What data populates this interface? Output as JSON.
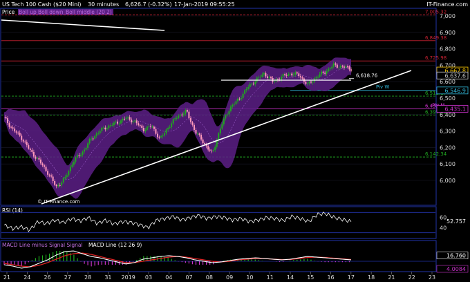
{
  "header": {
    "instrument": "US Tech 100 Cash ($20 Mini)",
    "interval": "30 minutes",
    "last": "6,626.7 (-0.32%)",
    "datetime": "17-Jan-2019 09:55:25",
    "brand": "IT-Finance.com",
    "copyright": "© IT-Finance.com"
  },
  "colors": {
    "background": "#000000",
    "price_up": "#1faa1f",
    "price_down": "#ff99bb",
    "bollinger_fill": "#5c1f86",
    "resistance": "#cc2233",
    "support": "#22aa22",
    "pivot_m": "#cc33cc",
    "pivot_w": "#33bbdd",
    "panel_border": "#2233aa"
  },
  "legend": {
    "price": "Price",
    "boll_up": "Boll up",
    "boll_down": "Boll down",
    "boll_middle": "Boll middle (20 2)",
    "rsi": "RSI (14)",
    "macd_hist": "MACD Line minus Signal Signal",
    "macd_line": "MACD Line (12 26 9)"
  },
  "chart_data": {
    "type": "candlestick",
    "price_axis": {
      "ticks": [
        "7,000",
        "6,900",
        "6,800",
        "6,700",
        "6,600",
        "6,500",
        "6,400",
        "6,300",
        "6,200",
        "6,100",
        "6,000"
      ],
      "ylim": [
        5950,
        7040
      ]
    },
    "levels": [
      {
        "label": "7,005.32",
        "value": 7005.32,
        "style": "dashed",
        "color": "#cc2233"
      },
      {
        "label": "6,849.38",
        "value": 6849.38,
        "style": "solid",
        "color": "#cc2233"
      },
      {
        "label": "6,725.98",
        "value": 6725.98,
        "style": "solid",
        "color": "#cc2233"
      },
      {
        "label": "6,618.76",
        "value": 6618.76,
        "style": "solid",
        "color": "#ffffff"
      },
      {
        "label": "6,512.17",
        "value": 6512.17,
        "style": "dashed",
        "color": "#22aa22"
      },
      {
        "label": "6,435.1",
        "value": 6435.1,
        "style": "solid",
        "color": "#cc33cc"
      },
      {
        "label": "6,397.51",
        "value": 6397.51,
        "style": "dashed",
        "color": "#22aa22"
      },
      {
        "label": "6,142.34",
        "value": 6142.34,
        "style": "dashed",
        "color": "#22aa22"
      }
    ],
    "pivots": [
      {
        "label": "Piv W",
        "value": 6546.9,
        "axis_label": "6,546.9",
        "color": "#33bbdd"
      },
      {
        "label": "Piv M",
        "value": 6435.1,
        "axis_label": "6,435.1",
        "color": "#cc33cc"
      }
    ],
    "price_tags": [
      {
        "label": "6,667.8",
        "value": 6667.8,
        "color": "#ffcc00"
      },
      {
        "label": "6,637.6",
        "value": 6637.6,
        "color": "#cccccc"
      }
    ],
    "x_ticks": [
      "21",
      "24",
      "26",
      "27",
      "28",
      "31",
      "2019",
      "03",
      "04",
      "07",
      "08",
      "09",
      "10",
      "11",
      "14",
      "15",
      "16",
      "17",
      "18",
      "21",
      "22",
      "23"
    ],
    "close_path": [
      6380,
      6310,
      6260,
      6180,
      6120,
      6050,
      5960,
      6010,
      6120,
      6170,
      6250,
      6300,
      6330,
      6350,
      6380,
      6360,
      6310,
      6330,
      6250,
      6330,
      6390,
      6420,
      6300,
      6230,
      6160,
      6330,
      6440,
      6490,
      6560,
      6610,
      6650,
      6600,
      6630,
      6650,
      6640,
      6580,
      6630,
      6660,
      6700,
      6690,
      6680
    ],
    "rsi": {
      "label": "RSI (14)",
      "ticks": [
        "60",
        "40"
      ],
      "value_label": "52.757",
      "levels": [
        70,
        30
      ],
      "path": [
        45,
        38,
        42,
        35,
        52,
        48,
        55,
        50,
        58,
        53,
        60,
        48,
        55,
        47,
        52,
        50,
        46,
        40,
        55,
        58,
        62,
        55,
        60,
        64,
        58,
        62,
        60,
        55,
        58,
        52,
        55,
        60,
        58,
        54,
        62,
        58,
        52,
        66,
        68,
        60,
        56,
        52
      ]
    },
    "macd": {
      "label": "MACD Line (12 26 9)",
      "hist_label": "MACD Line minus Signal Signal",
      "line_value_label": "16.760",
      "hist_value_label": "4.0084",
      "macd_path": [
        -10,
        -14,
        -20,
        -16,
        -6,
        4,
        18,
        28,
        30,
        22,
        14,
        10,
        4,
        -2,
        -8,
        -4,
        6,
        10,
        14,
        16,
        14,
        10,
        4,
        0,
        -4,
        -2,
        2,
        6,
        8,
        10,
        8,
        6,
        4,
        6,
        10,
        14,
        12,
        10,
        8,
        6,
        4
      ],
      "signal_path": [
        -6,
        -10,
        -14,
        -16,
        -12,
        -4,
        6,
        16,
        22,
        24,
        20,
        14,
        8,
        2,
        -4,
        -4,
        0,
        4,
        8,
        12,
        14,
        12,
        8,
        4,
        0,
        -2,
        0,
        4,
        6,
        8,
        8,
        6,
        5,
        5,
        8,
        11,
        12,
        11,
        9,
        7,
        5
      ]
    }
  }
}
